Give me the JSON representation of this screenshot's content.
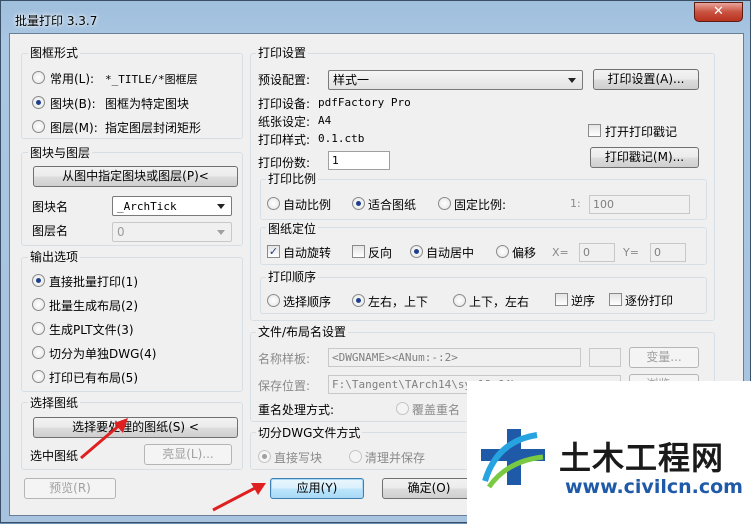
{
  "window": {
    "title": "批量打印 3.3.7",
    "close": "✕"
  },
  "frame_style": {
    "label": "图框形式",
    "options": [
      {
        "label": "常用(L):",
        "desc": "*_TITLE/*图框层",
        "selected": false
      },
      {
        "label": "图块(B):",
        "desc": "图框为特定图块",
        "selected": true
      },
      {
        "label": "图层(M):",
        "desc": "指定图层封闭矩形",
        "selected": false
      }
    ]
  },
  "block_layer": {
    "label": "图块与图层",
    "pick_button": "从图中指定图块或图层(P)<",
    "block_name_label": "图块名",
    "block_name_value": "_ArchTick",
    "layer_name_label": "图层名",
    "layer_name_value": "0"
  },
  "output": {
    "label": "输出选项",
    "options": [
      {
        "label": "直接批量打印(1)",
        "selected": true
      },
      {
        "label": "批量生成布局(2)",
        "selected": false
      },
      {
        "label": "生成PLT文件(3)",
        "selected": false
      },
      {
        "label": "切分为单独DWG(4)",
        "selected": false
      },
      {
        "label": "打印已有布局(5)",
        "selected": false
      }
    ]
  },
  "select_sheets": {
    "label": "选择图纸",
    "button": "选择要处理的图纸(S) <",
    "selected_label": "选中图纸",
    "highlight_button": "亮显(L)..."
  },
  "print_settings": {
    "label": "打印设置",
    "preset_label": "预设配置:",
    "preset_value": "样式一",
    "settings_button": "打印设置(A)...",
    "device_label": "打印设备:",
    "device_value": "pdfFactory Pro",
    "paper_label": "纸张设定:",
    "paper_value": "A4",
    "style_label": "打印样式:",
    "style_value": "0.1.ctb",
    "open_stamp_label": "打开打印戳记",
    "open_stamp_checked": false,
    "stamp_button": "打印戳记(M)...",
    "copies_label": "打印份数:",
    "copies_value": "1"
  },
  "scale": {
    "label": "打印比例",
    "options": [
      {
        "label": "自动比例",
        "selected": false
      },
      {
        "label": "适合图纸",
        "selected": true
      },
      {
        "label": "固定比例:",
        "selected": false
      }
    ],
    "ratio_prefix": "1:",
    "ratio_value": "100"
  },
  "positioning": {
    "label": "图纸定位",
    "auto_rotate": "自动旋转",
    "auto_rotate_checked": true,
    "reverse": "反向",
    "reverse_checked": false,
    "auto_center": "自动居中",
    "auto_center_selected": true,
    "offset": "偏移",
    "offset_selected": false,
    "x_label": "X=",
    "x_value": "0",
    "y_label": "Y=",
    "y_value": "0"
  },
  "order": {
    "label": "打印顺序",
    "options": [
      {
        "label": "选择顺序",
        "selected": false
      },
      {
        "label": "左右，上下",
        "selected": true
      },
      {
        "label": "上下，左右",
        "selected": false
      }
    ],
    "reverse_label": "逆序",
    "reverse_checked": false,
    "one_by_one_label": "逐份打印",
    "one_by_one_checked": false
  },
  "file_layout": {
    "label": "文件/布局名设置",
    "name_template_label": "名称样板:",
    "name_template_value": "<DWGNAME><ANum:-:2>",
    "change_button": "变量...",
    "save_location_label": "保存位置:",
    "save_location_value": "F:\\Tangent\\TArch14\\sys18x64\\",
    "browse_button": "浏览...",
    "rename_label": "重名处理方式:",
    "overwrite_label": "覆盖重名"
  },
  "split_dwg": {
    "label": "切分DWG文件方式",
    "direct_label": "直接写块",
    "cleanup_label": "清理并保存"
  },
  "footer": {
    "preview_button": "预览(R)",
    "apply_button": "应用(Y)",
    "ok_button": "确定(O)"
  },
  "watermark": {
    "brand": "土木工程网",
    "url": "www.civilcn.com"
  },
  "colors": {
    "brand_blue": "#1f5aa8",
    "annotation_red": "#e02020"
  }
}
